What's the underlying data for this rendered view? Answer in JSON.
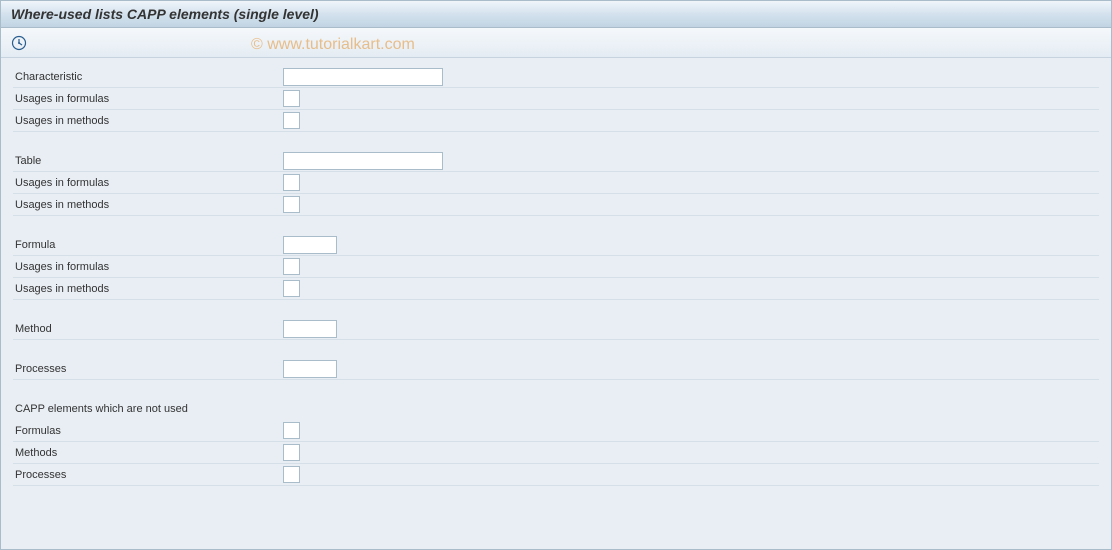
{
  "header": {
    "title": "Where-used lists CAPP elements (single level)"
  },
  "toolbar": {
    "execute_icon": "execute"
  },
  "watermark": "© www.tutorialkart.com",
  "groups": {
    "characteristic": {
      "main_label": "Characteristic",
      "main_value": "",
      "formulas_label": "Usages in formulas",
      "methods_label": "Usages in methods"
    },
    "table": {
      "main_label": "Table",
      "main_value": "",
      "formulas_label": "Usages in formulas",
      "methods_label": "Usages in methods"
    },
    "formula": {
      "main_label": "Formula",
      "main_value": "",
      "formulas_label": "Usages in formulas",
      "methods_label": "Usages in methods"
    },
    "method": {
      "main_label": "Method",
      "main_value": ""
    },
    "processes": {
      "main_label": "Processes",
      "main_value": ""
    },
    "not_used": {
      "heading": "CAPP elements which are not used",
      "formulas_label": "Formulas",
      "methods_label": "Methods",
      "processes_label": "Processes"
    }
  }
}
